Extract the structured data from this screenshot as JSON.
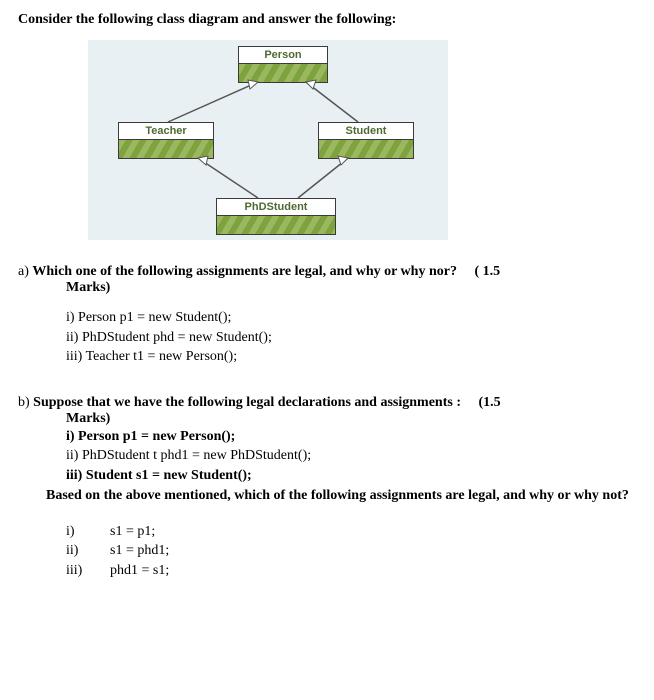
{
  "heading": "Consider the following class diagram and answer the following:",
  "diagram": {
    "person": "Person",
    "teacher": "Teacher",
    "student": "Student",
    "phdstudent": "PhDStudent"
  },
  "partA": {
    "label": "a) ",
    "question": "Which one of the following assignments are legal, and why or why nor?",
    "marks": "( 1.5",
    "marksWord": "Marks)",
    "items": {
      "i": "i) Person p1 = new Student();",
      "ii": "ii) PhDStudent  phd = new Student();",
      "iii": "iii) Teacher  t1 = new Person();"
    }
  },
  "partB": {
    "label": "b) ",
    "question": "Suppose that we have the following legal declarations and assignments :",
    "marks": "(1.5",
    "marksWord": "Marks)",
    "decls": {
      "i": "i) Person p1 = new Person();",
      "ii": "ii) PhDStudent t  phd1 = new PhDStudent();",
      "iii": "iii) Student s1 = new Student();"
    },
    "based": "Based on the above mentioned, which of the following assignments are legal, and why or why not?",
    "answers": {
      "i_num": "i)",
      "i_code": "s1 = p1;",
      "ii_num": "ii)",
      "ii_code": "s1 = phd1;",
      "iii_num": "iii)",
      "iii_code": "phd1 = s1;"
    }
  }
}
